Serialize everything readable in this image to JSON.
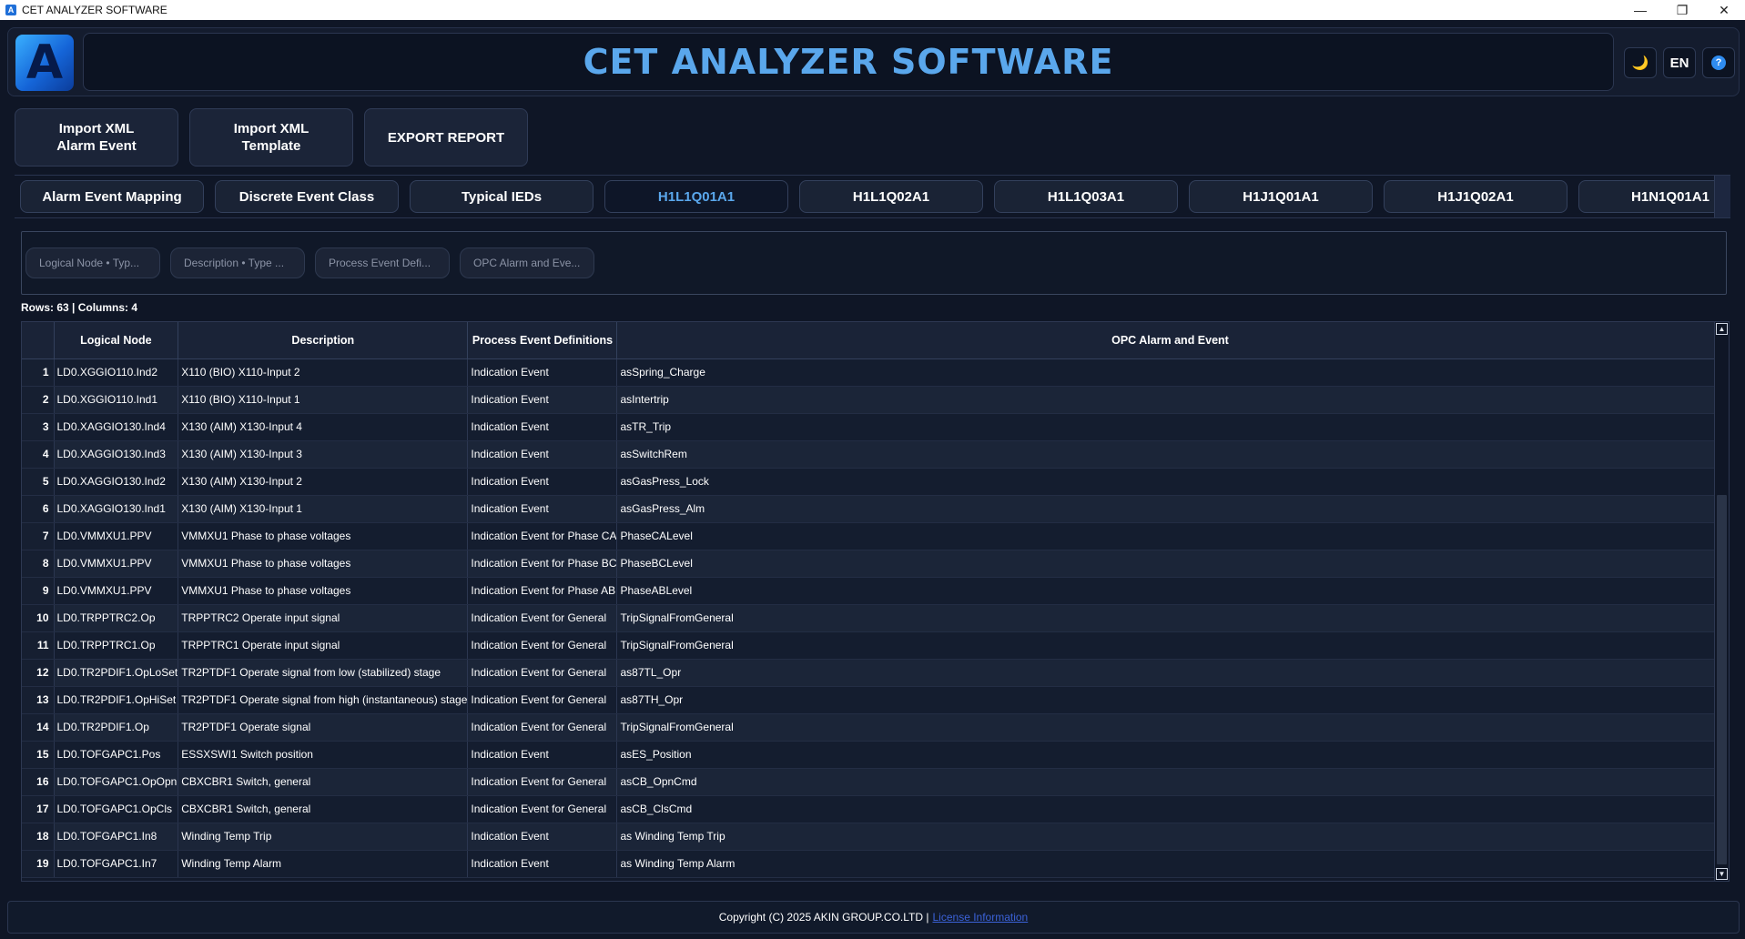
{
  "window": {
    "title": "CET ANALYZER SOFTWARE",
    "minimize": "—",
    "restore": "❐",
    "close": "✕"
  },
  "header": {
    "logo_letter": "A",
    "title": "CET ANALYZER SOFTWARE",
    "theme_icon": "🌙",
    "language": "EN",
    "help_icon": "?"
  },
  "actions": {
    "import_alarm": "Import XML\nAlarm Event",
    "import_template": "Import XML\nTemplate",
    "export_report": "EXPORT REPORT"
  },
  "tabs": [
    {
      "label": "Alarm Event Mapping"
    },
    {
      "label": "Discrete Event Class"
    },
    {
      "label": "Typical IEDs"
    },
    {
      "label": "H1L1Q01A1"
    },
    {
      "label": "H1L1Q02A1"
    },
    {
      "label": "H1L1Q03A1"
    },
    {
      "label": "H1J1Q01A1"
    },
    {
      "label": "H1J1Q02A1"
    },
    {
      "label": "H1N1Q01A1"
    }
  ],
  "active_tab": "H1L1Q01A1",
  "filters": {
    "logical_node": "Logical Node • Typ...",
    "description": "Description • Type ...",
    "process_event": "Process Event Defi...",
    "opc_alarm": "OPC Alarm and Eve..."
  },
  "table_info": {
    "text": "Rows: 63  |  Columns: 4"
  },
  "table": {
    "columns": [
      "Logical Node",
      "Description",
      "Process Event Definitions",
      "OPC Alarm and Event"
    ],
    "rows": [
      [
        "1",
        "LD0.XGGIO110.Ind2",
        "X110 (BIO) X110-Input 2",
        "Indication Event",
        "asSpring_Charge"
      ],
      [
        "2",
        "LD0.XGGIO110.Ind1",
        "X110 (BIO) X110-Input 1",
        "Indication Event",
        "asIntertrip"
      ],
      [
        "3",
        "LD0.XAGGIO130.Ind4",
        "X130 (AIM) X130-Input 4",
        "Indication Event",
        "asTR_Trip"
      ],
      [
        "4",
        "LD0.XAGGIO130.Ind3",
        "X130 (AIM) X130-Input 3",
        "Indication Event",
        "asSwitchRem"
      ],
      [
        "5",
        "LD0.XAGGIO130.Ind2",
        "X130 (AIM) X130-Input 2",
        "Indication Event",
        "asGasPress_Lock"
      ],
      [
        "6",
        "LD0.XAGGIO130.Ind1",
        "X130 (AIM) X130-Input 1",
        "Indication Event",
        "asGasPress_Alm"
      ],
      [
        "7",
        "LD0.VMMXU1.PPV",
        "VMMXU1 Phase to phase voltages",
        "Indication Event for Phase CA",
        "PhaseCALevel"
      ],
      [
        "8",
        "LD0.VMMXU1.PPV",
        "VMMXU1 Phase to phase voltages",
        "Indication Event for Phase BC",
        "PhaseBCLevel"
      ],
      [
        "9",
        "LD0.VMMXU1.PPV",
        "VMMXU1 Phase to phase voltages",
        "Indication Event for Phase AB",
        "PhaseABLevel"
      ],
      [
        "10",
        "LD0.TRPPTRC2.Op",
        "TRPPTRC2 Operate input signal",
        "Indication Event for General",
        "TripSignalFromGeneral"
      ],
      [
        "11",
        "LD0.TRPPTRC1.Op",
        "TRPPTRC1 Operate input signal",
        "Indication Event for General",
        "TripSignalFromGeneral"
      ],
      [
        "12",
        "LD0.TR2PDIF1.OpLoSet",
        "TR2PTDF1 Operate signal from low (stabilized) stage",
        "Indication Event for General",
        "as87TL_Opr"
      ],
      [
        "13",
        "LD0.TR2PDIF1.OpHiSet",
        "TR2PTDF1 Operate signal from high (instantaneous) stage",
        "Indication Event for General",
        "as87TH_Opr"
      ],
      [
        "14",
        "LD0.TR2PDIF1.Op",
        "TR2PTDF1 Operate signal",
        "Indication Event for General",
        "TripSignalFromGeneral"
      ],
      [
        "15",
        "LD0.TOFGAPC1.Pos",
        "ESSXSWI1 Switch position",
        "Indication Event",
        "asES_Position"
      ],
      [
        "16",
        "LD0.TOFGAPC1.OpOpn",
        "CBXCBR1 Switch, general",
        "Indication Event for General",
        "asCB_OpnCmd"
      ],
      [
        "17",
        "LD0.TOFGAPC1.OpCls",
        "CBXCBR1 Switch, general",
        "Indication Event for General",
        "asCB_ClsCmd"
      ],
      [
        "18",
        "LD0.TOFGAPC1.In8",
        "Winding Temp Trip",
        "Indication Event",
        "as Winding Temp Trip"
      ],
      [
        "19",
        "LD0.TOFGAPC1.In7",
        "Winding Temp Alarm",
        "Indication Event",
        "as Winding Temp Alarm"
      ]
    ]
  },
  "footer": {
    "copyright": "Copyright (C) 2025 AKIN GROUP.CO.LTD |",
    "license_link": "License Information"
  },
  "colors": {
    "background": "#0f1626",
    "accent": "#5aa7ec",
    "link": "#3b62d8"
  }
}
